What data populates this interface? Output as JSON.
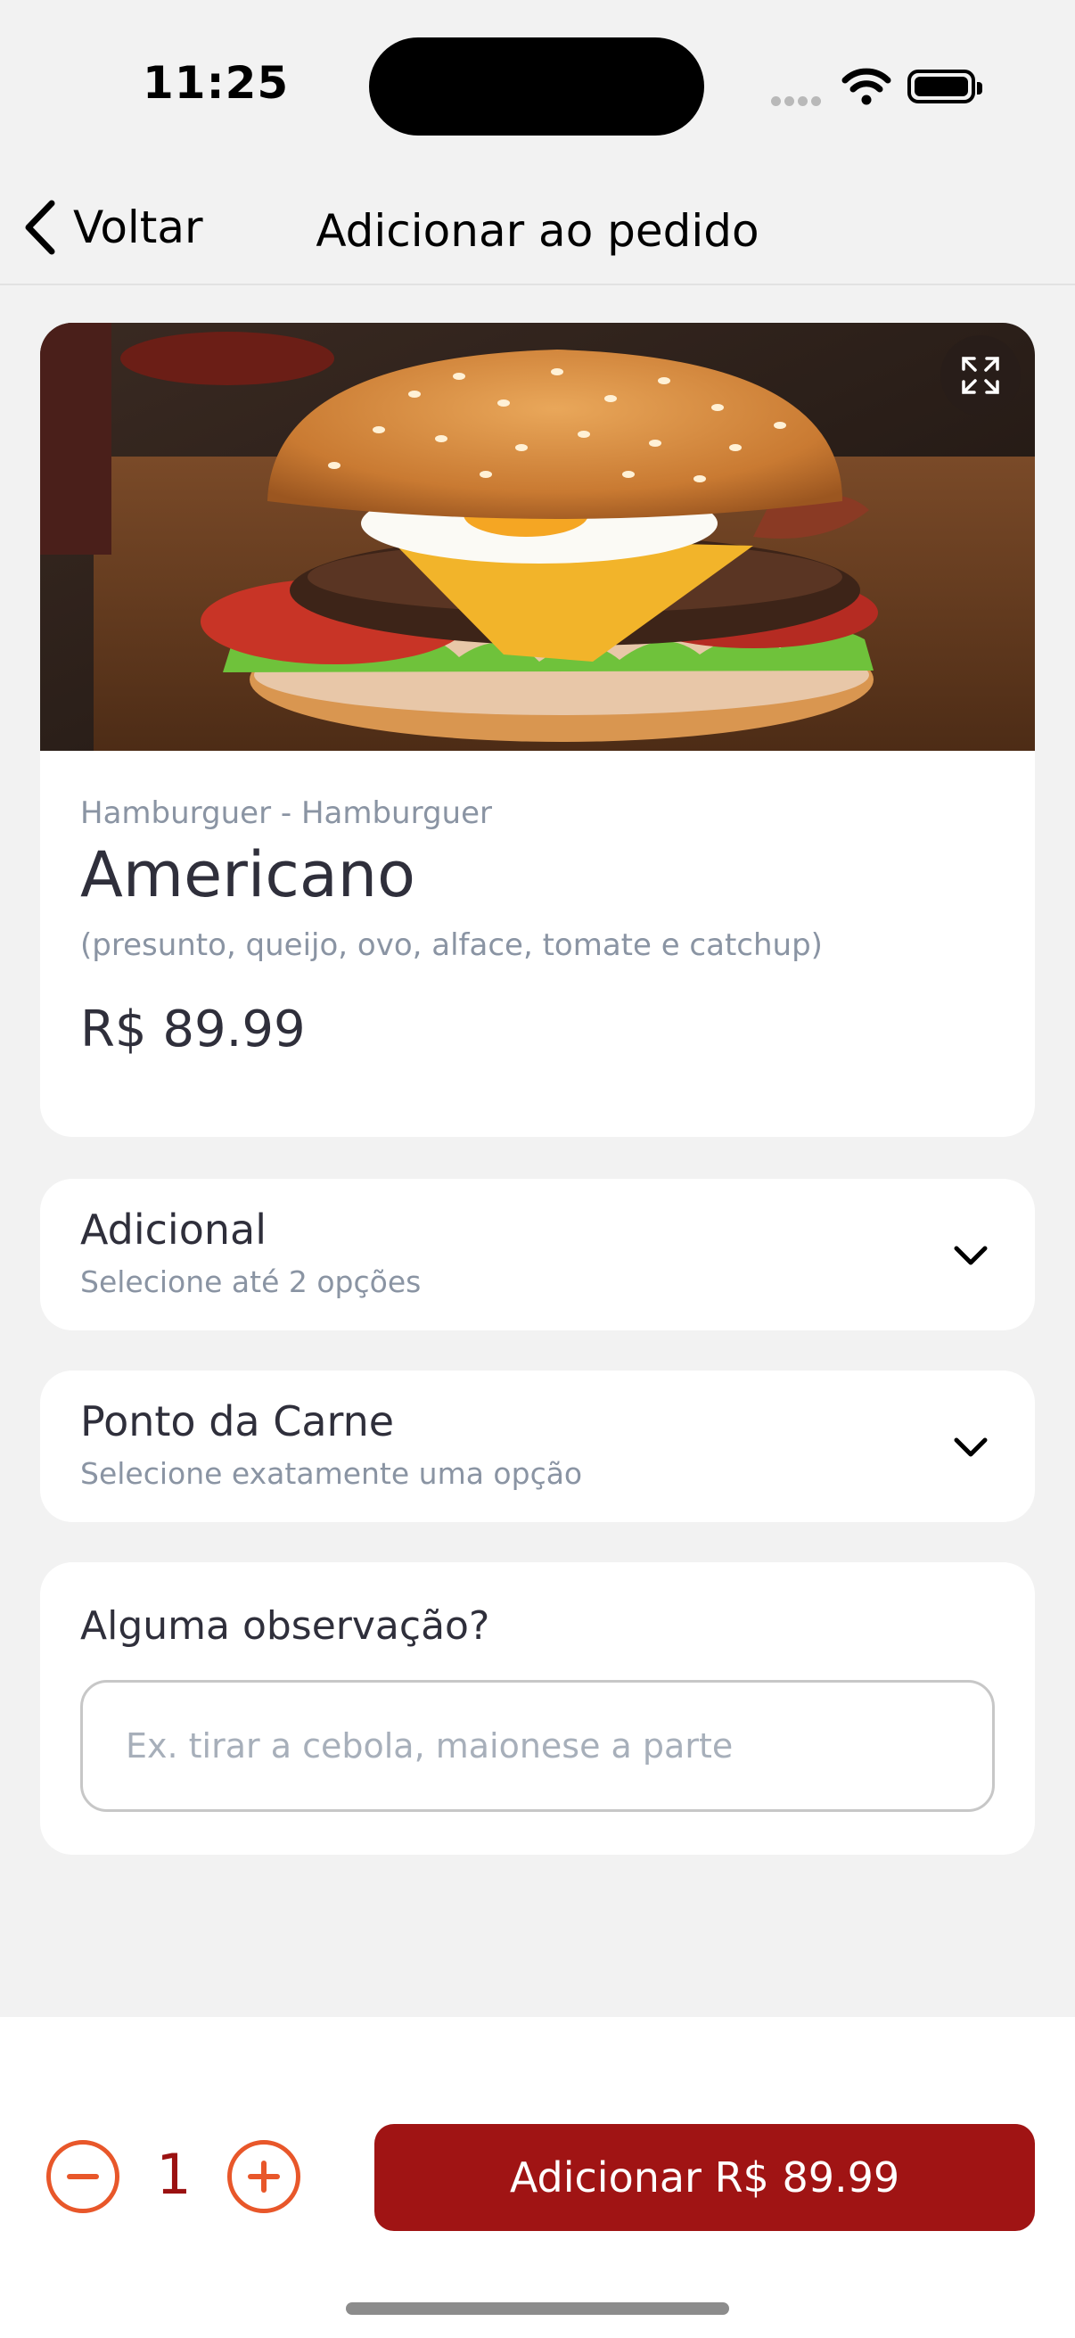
{
  "status_bar": {
    "time": "11:25"
  },
  "nav": {
    "back_label": "Voltar",
    "title": "Adicionar ao pedido"
  },
  "product": {
    "image": "hamburger-photo",
    "breadcrumb": "Hamburguer - Hamburguer",
    "name": "Americano",
    "description": "(presunto, queijo, ovo, alface, tomate e catchup)",
    "price": "R$ 89.99"
  },
  "options": [
    {
      "title": "Adicional",
      "subtitle": "Selecione até 2 opções"
    },
    {
      "title": "Ponto da Carne",
      "subtitle": "Selecione exatamente uma opção"
    }
  ],
  "observation": {
    "title": "Alguma observação?",
    "value": "",
    "placeholder": "Ex. tirar a cebola, maionese a parte"
  },
  "order": {
    "quantity": "1",
    "add_label": "Adicionar R$ 89.99"
  },
  "colors": {
    "accent": "#a01414",
    "qty_accent": "#e8572a",
    "qty_text": "#9b1111"
  }
}
